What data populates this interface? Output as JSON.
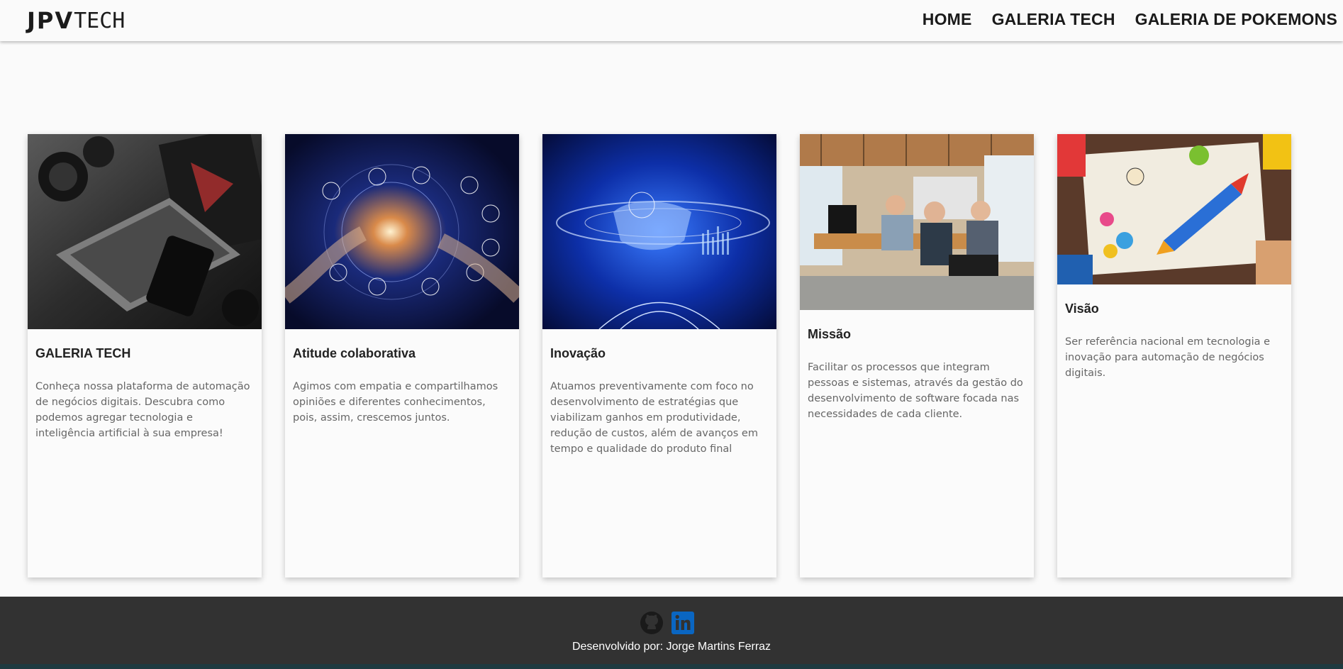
{
  "header": {
    "logo_bold": "JPV",
    "logo_light": "TECH",
    "nav": [
      "HOME",
      "GALERIA TECH",
      "GALERIA DE POKEMONS"
    ]
  },
  "cards": [
    {
      "title": "GALERIA TECH",
      "description": "Conheça nossa plataforma de automação de negócios digitais. Descubra como podemos agregar tecnologia e inteligência artificial à sua empresa!",
      "image": "laptop-camera-photo"
    },
    {
      "title": "Atitude colaborativa",
      "description": "Agimos com empatia e compartilhamos opiniões e diferentes conhecimentos, pois, assim, crescemos juntos.",
      "image": "network-globe-photo"
    },
    {
      "title": "Inovação",
      "description": "Atuamos preventivamente com foco no desenvolvimento de estratégias que viabilizam ganhos em produtividade, redução de custos, além de avanços em tempo e qualidade do produto final",
      "image": "digital-hand-photo"
    },
    {
      "title": "Missão",
      "description": "Facilitar os processos que integram pessoas e sistemas, através da gestão do desenvolvimento de software focada nas necessidades de cada cliente.",
      "image": "office-team-photo"
    },
    {
      "title": "Visão",
      "description": "Ser referência nacional em tecnologia e inovação para automação de negócios digitais.",
      "image": "startup-sketch-photo"
    }
  ],
  "footer": {
    "credit": "Desenvolvido por: Jorge Martins Ferraz",
    "icons": [
      "github-icon",
      "linkedin-icon"
    ]
  },
  "colors": {
    "background": "#fafafa",
    "footer": "#323232",
    "linkedin": "#0a66c2",
    "text_dark": "#222222",
    "text_muted": "#666666"
  }
}
